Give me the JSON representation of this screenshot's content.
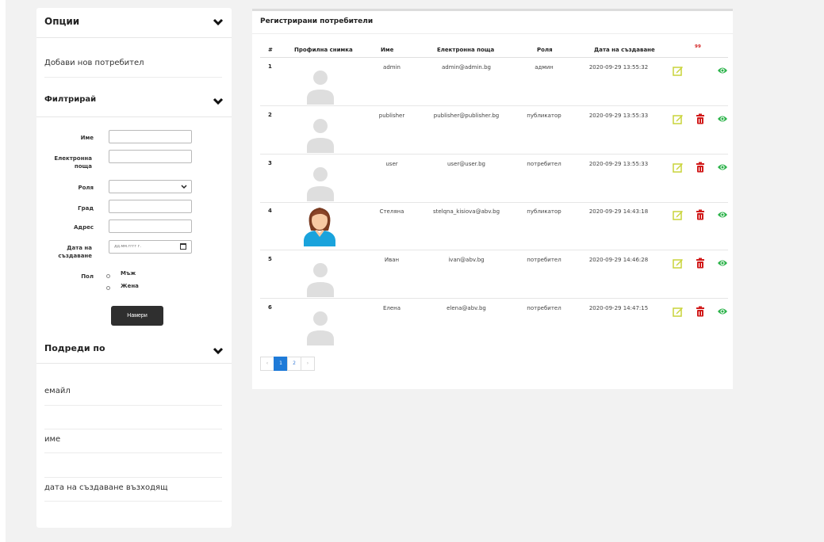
{
  "options": {
    "title": "Опции",
    "add_user": "Добави нов потребител"
  },
  "filter": {
    "title": "Филтрирай",
    "fields": {
      "name": "Име",
      "email": "Електронна поща",
      "role": "Роля",
      "city": "Град",
      "address": "Адрес",
      "created": "Дата на създаване",
      "gender": "Пол"
    },
    "date_placeholder": "дд.мм.гггг г.",
    "gender_options": [
      "Мъж",
      "Жена"
    ],
    "search_button": "Намери"
  },
  "sort": {
    "title": "Подреди по",
    "options": [
      "емайл",
      "име",
      "дата на създаване възходящ"
    ]
  },
  "table": {
    "title": "Регистрирани потребители",
    "headers": {
      "num": "#",
      "photo": "Профилна снимка",
      "name": "Име",
      "email": "Електронна поща",
      "role": "Роля",
      "created": "Дата на създаване",
      "actions_marker": "⁹⁹"
    },
    "rows": [
      {
        "num": "1",
        "name": "admin",
        "email": "admin@admin.bg",
        "role": "админ",
        "created": "2020-09-29 13:55:32",
        "avatar": "placeholder",
        "delete": false
      },
      {
        "num": "2",
        "name": "publisher",
        "email": "publisher@publisher.bg",
        "role": "публикатор",
        "created": "2020-09-29 13:55:33",
        "avatar": "placeholder",
        "delete": true
      },
      {
        "num": "3",
        "name": "user",
        "email": "user@user.bg",
        "role": "потребител",
        "created": "2020-09-29 13:55:33",
        "avatar": "placeholder",
        "delete": true
      },
      {
        "num": "4",
        "name": "Стеляна",
        "email": "stelqna_kisiova@abv.bg",
        "role": "публикатор",
        "created": "2020-09-29 14:43:18",
        "avatar": "woman",
        "delete": true
      },
      {
        "num": "5",
        "name": "Иван",
        "email": "ivan@abv.bg",
        "role": "потребител",
        "created": "2020-09-29 14:46:28",
        "avatar": "placeholder",
        "delete": true
      },
      {
        "num": "6",
        "name": "Елена",
        "email": "elena@abv.bg",
        "role": "потребител",
        "created": "2020-09-29 14:47:15",
        "avatar": "placeholder",
        "delete": true
      }
    ]
  },
  "pagination": {
    "prev": "‹",
    "pages": [
      "1",
      "2"
    ],
    "current": "1",
    "next": "›"
  },
  "colors": {
    "edit": "#c9d43a",
    "delete": "#d11a1a",
    "view": "#2cb34a",
    "accent": "#1f7bd8"
  },
  "icons": [
    "chevron-down-icon",
    "calendar-icon",
    "edit-icon",
    "delete-icon",
    "view-icon",
    "avatar-placeholder-icon",
    "avatar-woman-icon"
  ]
}
